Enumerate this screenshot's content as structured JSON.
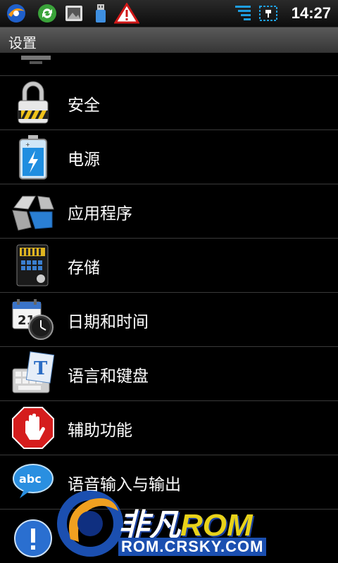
{
  "status_bar": {
    "time": "14:27",
    "icons": [
      "orbit-icon",
      "sync-icon",
      "photo-icon",
      "usb-icon",
      "warning-icon",
      "signal-icon",
      "battery-charging-icon"
    ]
  },
  "header": {
    "title": "设置"
  },
  "settings_list": {
    "items": [
      {
        "label": "安全",
        "icon": "lock-icon"
      },
      {
        "label": "电源",
        "icon": "battery-icon"
      },
      {
        "label": "应用程序",
        "icon": "apps-icon"
      },
      {
        "label": "存储",
        "icon": "sd-card-icon"
      },
      {
        "label": "日期和时间",
        "icon": "calendar-clock-icon"
      },
      {
        "label": "语言和键盘",
        "icon": "keyboard-icon"
      },
      {
        "label": "辅助功能",
        "icon": "hand-stop-icon"
      },
      {
        "label": "语音输入与输出",
        "icon": "speech-bubble-icon"
      }
    ]
  },
  "watermark": {
    "brand_a": "非凡",
    "brand_b": "ROM",
    "url": "ROM.CRSKY.COM"
  },
  "colors": {
    "accent_yellow": "#e8d21a",
    "accent_blue": "#1b4fb0",
    "divider": "#3a3a3a"
  }
}
